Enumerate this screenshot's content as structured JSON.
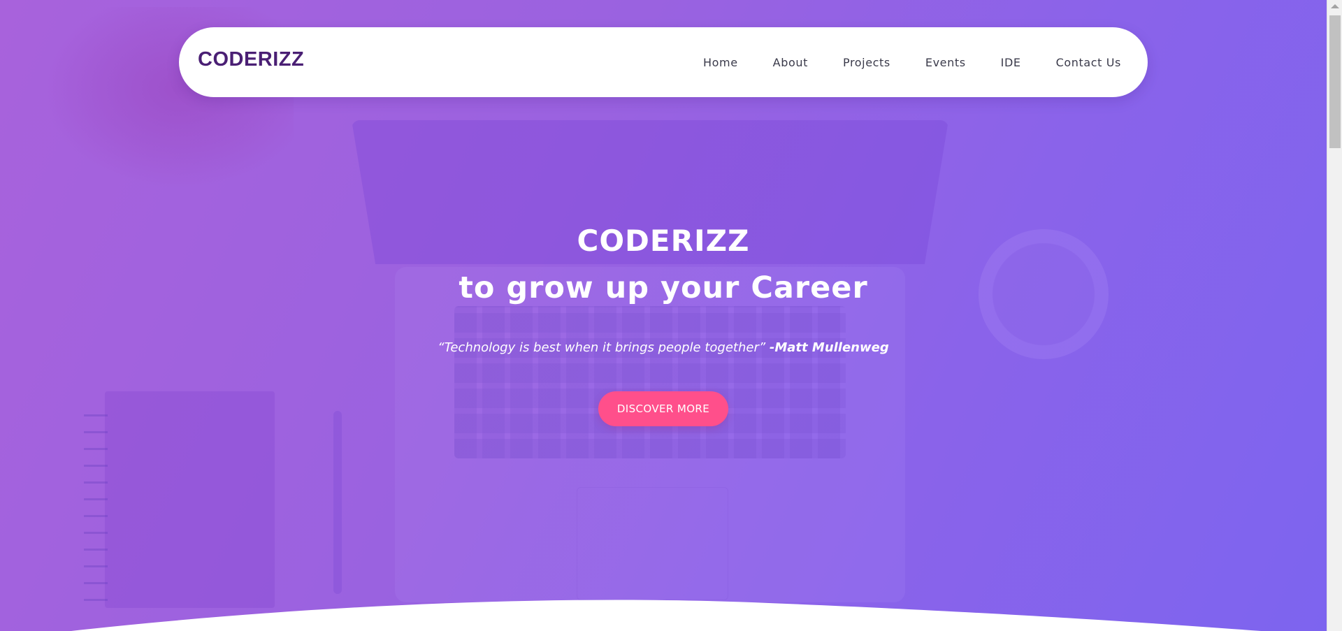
{
  "brand": {
    "logo_text": "CODERIZZ",
    "logo_color": "#4a1f74"
  },
  "nav": {
    "items": [
      {
        "label": "Home"
      },
      {
        "label": "About"
      },
      {
        "label": "Projects"
      },
      {
        "label": "Events"
      },
      {
        "label": "IDE"
      },
      {
        "label": "Contact Us"
      }
    ]
  },
  "hero": {
    "title": "CODERIZZ",
    "subtitle_prefix": "to grow up your",
    "subtitle_emphasis": "Career",
    "quote_text": "“Technology is best when it brings people together”",
    "quote_author": "-Matt Mullenweg",
    "cta_label": "DISCOVER MORE",
    "gradient_start": "#a862dc",
    "gradient_end": "#7d64ef",
    "cta_color": "#ff4f8b"
  },
  "icons": {
    "scroll_up": "chevron-up-icon"
  }
}
